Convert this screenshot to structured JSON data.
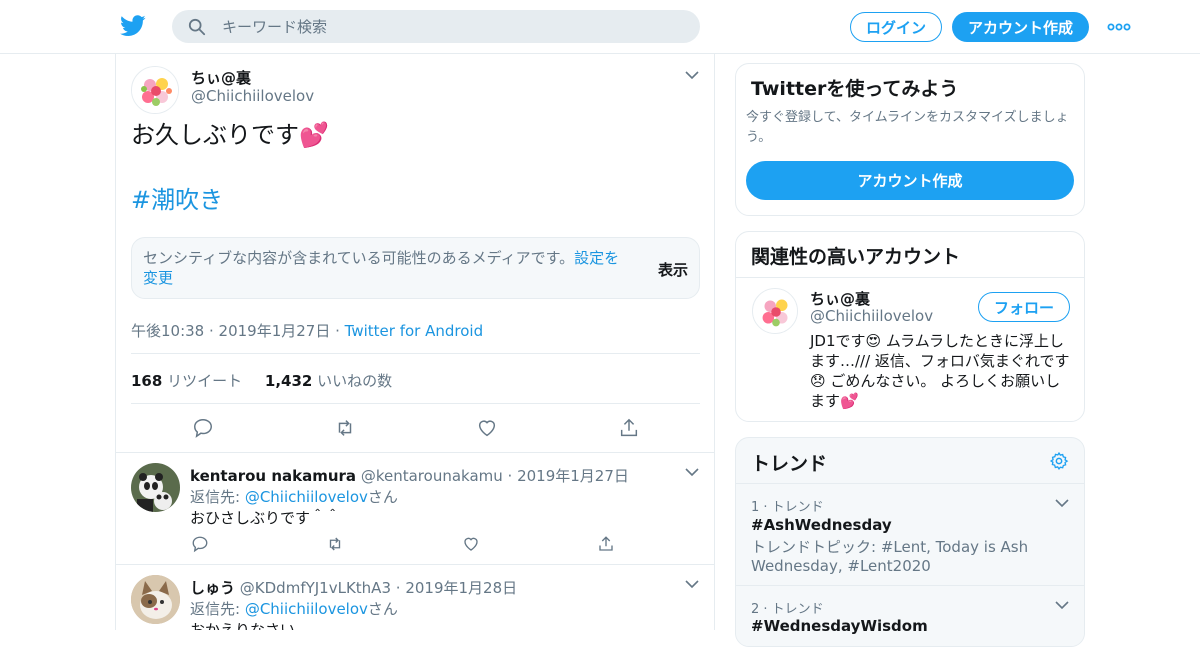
{
  "header": {
    "search_placeholder": "キーワード検索",
    "login_label": "ログイン",
    "signup_label": "アカウント作成"
  },
  "tweet": {
    "name": "ちぃ@裏",
    "handle": "@Chiichiilovelov",
    "text": "お久しぶりです💕",
    "hashtag": "#潮吹き",
    "sensitive_text": "センシティブな内容が含まれている可能性のあるメディアです。",
    "sensitive_link": "設定を変更",
    "show_label": "表示",
    "timestamp": "午後10:38 · 2019年1月27日 · ",
    "source": "Twitter for Android",
    "retweets_count": "168",
    "retweets_label": "リツイート",
    "likes_count": "1,432",
    "likes_label": "いいねの数"
  },
  "replies": [
    {
      "name": "kentarou nakamura",
      "handle": "@kentarounakamu",
      "date": "· 2019年1月27日",
      "reply_to_prefix": "返信先: ",
      "reply_to": "@Chiichiilovelov",
      "reply_to_suffix": "さん",
      "text": "おひさしぶりです＾＾"
    },
    {
      "name": "しゅう",
      "handle": "@KDdmfYJ1vLKthA3",
      "date": "· 2019年1月28日",
      "reply_to_prefix": "返信先: ",
      "reply_to": "@Chiichiilovelov",
      "reply_to_suffix": "さん",
      "text": "おかえりなさい"
    }
  ],
  "signup_card": {
    "title": "Twitterを使ってみよう",
    "description": "今すぐ登録して、タイムラインをカスタマイズしましょう。",
    "button": "アカウント作成"
  },
  "related_card": {
    "title": "関連性の高いアカウント",
    "name": "ちぃ@裏",
    "handle": "@Chiichiilovelov",
    "follow_label": "フォロー",
    "bio": "JD1です😍 ムラムラしたときに浮上します…/// 返信、フォロバ気まぐれです😞 ごめんなさい。 よろしくお願いします💕"
  },
  "trends_card": {
    "title": "トレンド",
    "items": [
      {
        "rank": "1 · トレンド",
        "tag": "#AshWednesday",
        "topic": "トレンドトピック: #Lent, Today is Ash Wednesday, #Lent2020"
      },
      {
        "rank": "2 · トレンド",
        "tag": "#WednesdayWisdom"
      }
    ]
  },
  "colors": {
    "accent": "#1da1f2",
    "link": "#1b95e0",
    "muted": "#657786",
    "border": "#e6ecf0",
    "bg_alt": "#f5f8fa"
  }
}
